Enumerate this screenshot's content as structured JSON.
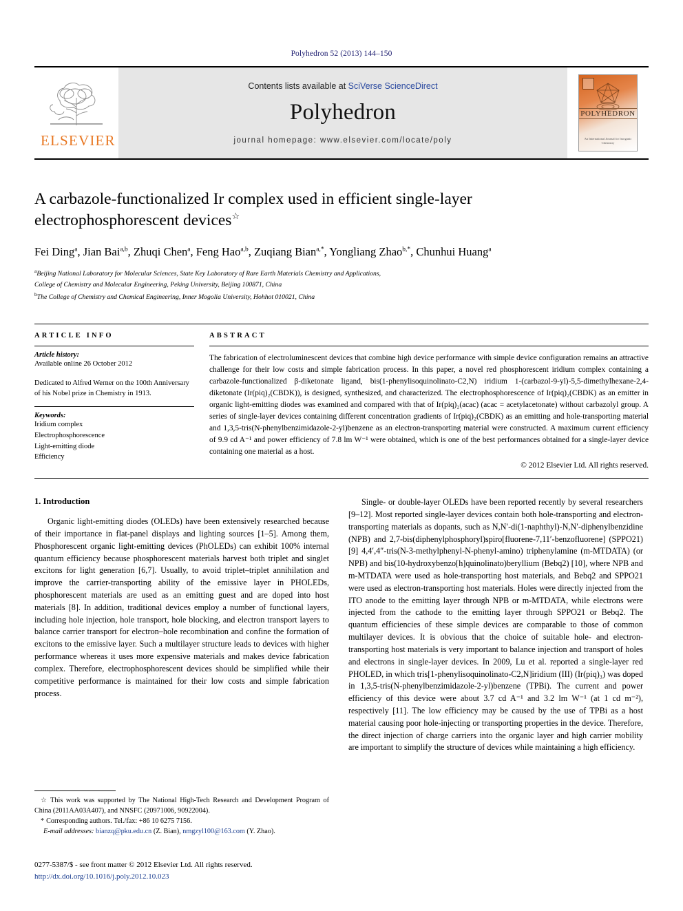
{
  "running_head": "Polyhedron 52 (2013) 144–150",
  "masthead": {
    "contents_prefix": "Contents lists available at ",
    "sciencedirect": "SciVerse ScienceDirect",
    "journal_name": "Polyhedron",
    "homepage": "journal homepage: www.elsevier.com/locate/poly",
    "publisher_logo_text": "ELSEVIER",
    "cover_title": "POLYHEDRON",
    "cover_footer": "An International Journal for\nInorganic Chemistry",
    "accent_orange": "#E87722",
    "link_blue": "#2b4aa0"
  },
  "title": {
    "line1": "A carbazole-functionalized Ir complex used in efficient single-layer",
    "line2": "electrophosphorescent devices",
    "footnote_marker": "☆"
  },
  "authors": {
    "list": [
      {
        "name": "Fei Ding",
        "sup": "a",
        "sep": ", "
      },
      {
        "name": "Jian Bai",
        "sup": "a,b",
        "sep": ", "
      },
      {
        "name": "Zhuqi Chen",
        "sup": "a",
        "sep": ", "
      },
      {
        "name": "Feng Hao",
        "sup": "a,b",
        "sep": ", "
      },
      {
        "name": "Zuqiang Bian",
        "sup": "a,*",
        "sep": ", "
      },
      {
        "name": "Yongliang Zhao",
        "sup": "b,*",
        "sep": ", "
      },
      {
        "name": "Chunhui Huang",
        "sup": "a",
        "sep": ""
      }
    ],
    "full_line": "Fei Ding a, Jian Bai a,b, Zhuqi Chen a, Feng Hao a,b, Zuqiang Bian a,*, Yongliang Zhao b,*, Chunhui Huang a"
  },
  "affiliations": [
    {
      "sup": "a",
      "text": "Beijing National Laboratory for Molecular Sciences, State Key Laboratory of Rare Earth Materials Chemistry and Applications,"
    },
    {
      "sup": "",
      "text": "College of Chemistry and Molecular Engineering, Peking University, Beijing 100871, China"
    },
    {
      "sup": "b",
      "text": "The College of Chemistry and Chemical Engineering, Inner Mogolia University, Hohhot 010021, China"
    }
  ],
  "article_info": {
    "heading": "ARTICLE INFO",
    "history_label": "Article history:",
    "history_value": "Available online 26 October 2012",
    "dedication": "Dedicated to Alfred Werner on the 100th Anniversary of his Nobel prize in Chemistry in 1913.",
    "keywords_label": "Keywords:",
    "keywords": [
      "Iridium complex",
      "Electrophosphorescence",
      "Light-emitting diode",
      "Efficiency"
    ]
  },
  "abstract": {
    "heading": "ABSTRACT",
    "text": "The fabrication of electroluminescent devices that combine high device performance with simple device configuration remains an attractive challenge for their low costs and simple fabrication process. In this paper, a novel red phosphorescent iridium complex containing a carbazole-functionalized β-diketonate ligand, bis(1-phenylisoquinolinato-C2,N) iridium 1-(carbazol-9-yl)-5,5-dimethylhexane-2,4-diketonate (Ir(piq)₂(CBDK)), is designed, synthesized, and characterized. The electrophosphorescence of Ir(piq)₂(CBDK) as an emitter in organic light-emitting diodes was examined and compared with that of Ir(piq)₂(acac) (acac = acetylacetonate) without carbazolyl group. A series of single-layer devices containing different concentration gradients of Ir(piq)₂(CBDK) as an emitting and hole-transporting material and 1,3,5-tris(N-phenylbenzimidazole-2-yl)benzene as an electron-transporting material were constructed. A maximum current efficiency of 9.9 cd A⁻¹ and power efficiency of 7.8 lm W⁻¹ were obtained, which is one of the best performances obtained for a single-layer device containing one material as a host.",
    "copyright": "© 2012 Elsevier Ltd. All rights reserved."
  },
  "sections": {
    "intro_title": "1. Introduction",
    "intro_p1": "Organic light-emitting diodes (OLEDs) have been extensively researched because of their importance in flat-panel displays and lighting sources [1–5]. Among them, Phosphorescent organic light-emitting devices (PhOLEDs) can exhibit 100% internal quantum efficiency because phosphorescent materials harvest both triplet and singlet excitons for light generation [6,7]. Usually, to avoid triplet–triplet annihilation and improve the carrier-transporting ability of the emissive layer in PHOLEDs, phosphorescent materials are used as an emitting guest and are doped into host materials [8]. In addition, traditional devices employ a number of functional layers, including hole injection, hole transport, hole blocking, and electron transport layers to balance carrier transport for electron–hole recombination and confine the formation of excitons to the emissive layer. Such a multilayer structure leads to devices with higher performance whereas it uses more expensive materials and makes device fabrication complex. Therefore, electrophosphorescent devices should be simplified while their competitive performance is maintained for their low costs and simple fabrication process.",
    "intro_p2": "Single- or double-layer OLEDs have been reported recently by several researchers [9–12]. Most reported single-layer devices contain both hole-transporting and electron-transporting materials as dopants, such as N,N′-di(1-naphthyl)-N,N′-diphenylbenzidine (NPB) and 2,7-bis(diphenylphosphoryl)spiro[fluorene-7,11′-benzofluorene] (SPPO21) [9] 4,4′,4″-tris(N-3-methylphenyl-N-phenyl-amino) triphenylamine (m-MTDATA) (or NPB) and bis(10-hydroxybenzo[h]quinolinato)beryllium (Bebq2) [10], where NPB and m-MTDATA were used as hole-transporting host materials, and Bebq2 and SPPO21 were used as electron-transporting host materials. Holes were directly injected from the ITO anode to the emitting layer through NPB or m-MTDATA, while electrons were injected from the cathode to the emitting layer through SPPO21 or Bebq2. The quantum efficiencies of these simple devices are comparable to those of common multilayer devices. It is obvious that the choice of suitable hole- and electron-transporting host materials is very important to balance injection and transport of holes and electrons in single-layer devices. In 2009, Lu et al. reported a single-layer red PHOLED, in which tris[1-phenylisoquinolinato-C2,N]iridium (III) (Ir(piq)₃) was doped in 1,3,5-tris(N-phenylbenzimidazole-2-yl)benzene (TPBi). The current and power efficiency of this device were about 3.7 cd A⁻¹ and 3.2 lm W⁻¹ (at 1 cd m⁻²), respectively [11]. The low efficiency may be caused by the use of TPBi as a host material causing poor hole-injecting or transporting properties in the device. Therefore, the direct injection of charge carriers into the organic layer and high carrier mobility are important to simplify the structure of devices while maintaining a high efficiency."
  },
  "footnotes": {
    "star_marker": "☆",
    "star_text": "This work was supported by The National High-Tech Research and Development Program of China (2011AA03A407), and NNSFC (20971006, 90922004).",
    "corr_marker": "*",
    "corr_text": "Corresponding authors. Tel./fax: +86 10 6275 7156.",
    "email_label": "E-mail addresses:",
    "email1": "bianzq@pku.edu.cn",
    "email1_owner": "(Z. Bian)",
    "email2": "nmgzyl100@163.com",
    "email2_owner": "(Y. Zhao)."
  },
  "page_footer": {
    "issn": "0277-5387/$ - see front matter © 2012 Elsevier Ltd. All rights reserved.",
    "doi": "http://dx.doi.org/10.1016/j.poly.2012.10.023"
  }
}
